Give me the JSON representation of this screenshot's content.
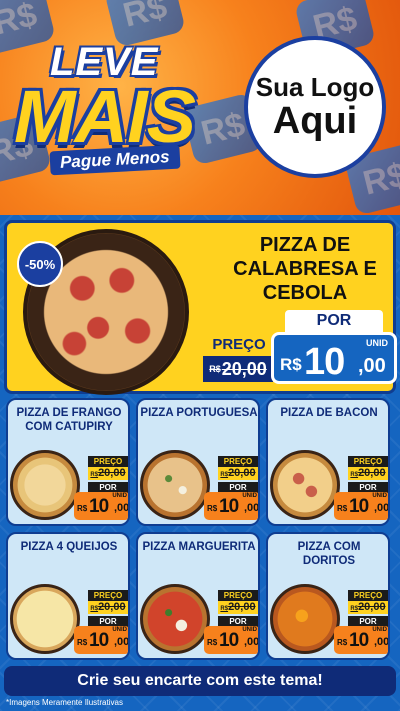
{
  "header": {
    "tiles_text": "R$",
    "brand": {
      "line1": "LEVE",
      "line2": "MAIS",
      "line3": "Pague Menos"
    },
    "logo": {
      "line1": "Sua Logo",
      "line2": "Aqui"
    }
  },
  "featured": {
    "discount": "-50%",
    "name": "PIZZA DE CALABRESA E CEBOLA",
    "preco_label": "PREÇO",
    "old_currency": "R$",
    "old_price": "20,00",
    "por_label": "POR",
    "currency": "R$",
    "price_int": "10",
    "price_dec": ",00",
    "unit": "UNID"
  },
  "cards": [
    {
      "name": "PIZZA DE FRANGO COM CATUPIRY",
      "preco_label": "PREÇO",
      "old_currency": "R$",
      "old_price": "20,00",
      "por_label": "POR",
      "currency": "R$",
      "price_int": "10",
      "price_dec": ",00",
      "unit": "UNID"
    },
    {
      "name": "PIZZA PORTUGUESA",
      "preco_label": "PREÇO",
      "old_currency": "R$",
      "old_price": "20,00",
      "por_label": "POR",
      "currency": "R$",
      "price_int": "10",
      "price_dec": ",00",
      "unit": "UNID"
    },
    {
      "name": "PIZZA DE BACON",
      "preco_label": "PREÇO",
      "old_currency": "R$",
      "old_price": "20,00",
      "por_label": "POR",
      "currency": "R$",
      "price_int": "10",
      "price_dec": ",00",
      "unit": "UNID"
    },
    {
      "name": "PIZZA 4 QUEIJOS",
      "preco_label": "PREÇO",
      "old_currency": "R$",
      "old_price": "20,00",
      "por_label": "POR",
      "currency": "R$",
      "price_int": "10",
      "price_dec": ",00",
      "unit": "UNID"
    },
    {
      "name": "PIZZA MARGUERITA",
      "preco_label": "PREÇO",
      "old_currency": "R$",
      "old_price": "20,00",
      "por_label": "POR",
      "currency": "R$",
      "price_int": "10",
      "price_dec": ",00",
      "unit": "UNID"
    },
    {
      "name": "PIZZA COM DORITOS",
      "preco_label": "PREÇO",
      "old_currency": "R$",
      "old_price": "20,00",
      "por_label": "POR",
      "currency": "R$",
      "price_int": "10",
      "price_dec": ",00",
      "unit": "UNID"
    }
  ],
  "cta": "Crie seu encarte com este tema!",
  "footnote": "*Imagens Meramente Ilustrativas",
  "colors": {
    "orange": "#f7811c",
    "yellow": "#ffd21f",
    "blue": "#1565c0",
    "navy": "#0f2b78",
    "card_bg": "#cfe7f7"
  }
}
